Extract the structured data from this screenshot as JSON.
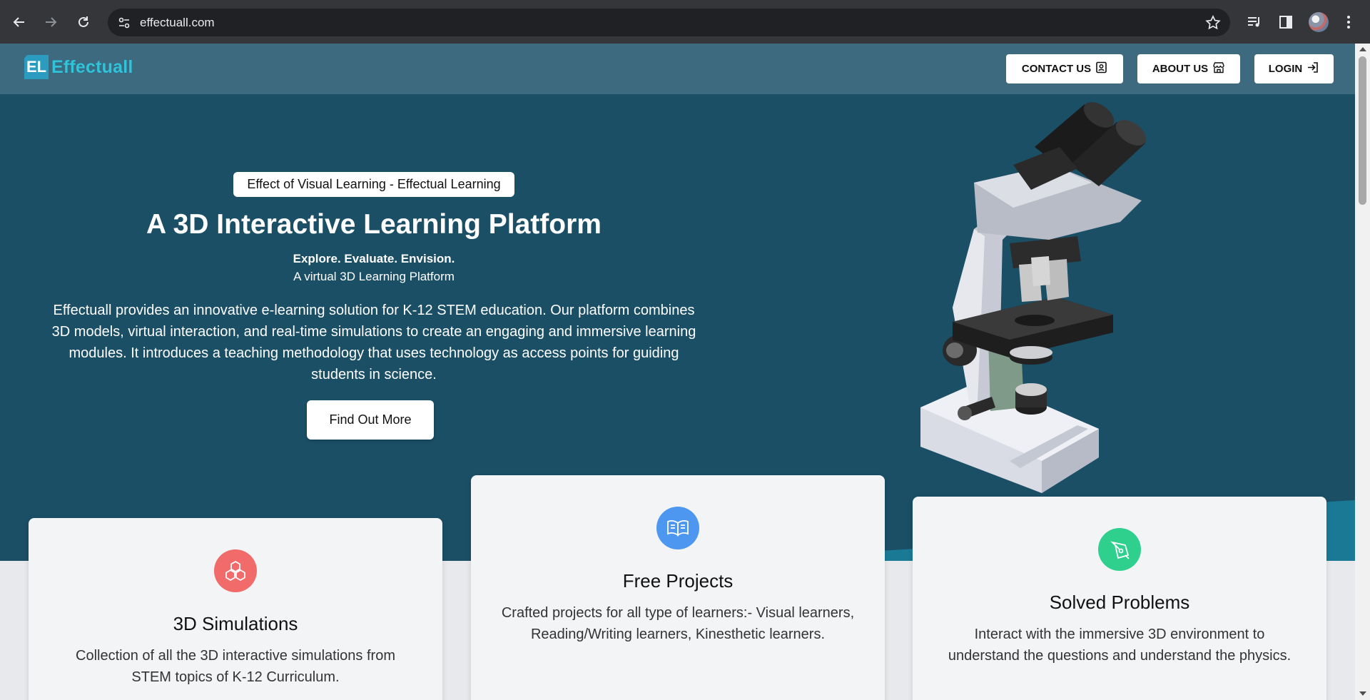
{
  "browser": {
    "url": "effectuall.com",
    "icons": [
      "back-icon",
      "forward-icon",
      "reload-icon",
      "site-info-icon",
      "bookmark-star-icon",
      "media-controls-icon",
      "side-panel-icon",
      "profile-avatar",
      "more-menu-icon"
    ]
  },
  "header": {
    "logo_mark": "EL",
    "logo_text": "Effectuall",
    "nav": [
      {
        "label": "CONTACT US",
        "icon": "contact-card-icon"
      },
      {
        "label": "ABOUT US",
        "icon": "store-icon"
      },
      {
        "label": "LOGIN",
        "icon": "login-icon"
      }
    ]
  },
  "hero": {
    "badge": "Effect of Visual Learning - Effectual Learning",
    "title": "A 3D Interactive Learning Platform",
    "tagline": "Explore. Evaluate. Envision.",
    "subtitle": "A virtual 3D Learning Platform",
    "description": "Effectuall provides an innovative e-learning solution for K-12 STEM education. Our platform combines 3D models, virtual interaction, and real-time simulations to create an engaging and immersive learning modules. It introduces a teaching methodology that uses technology as access points for guiding students in science.",
    "cta": "Find Out More",
    "image": "microscope-3d-model"
  },
  "features": [
    {
      "title": "3D Simulations",
      "description": "Collection of all the 3D interactive simulations from STEM topics of K-12 Curriculum.",
      "icon": "cubes-icon",
      "color": "#f16b6b"
    },
    {
      "title": "Free Projects",
      "description": "Crafted projects for all type of learners:- Visual learners, Reading/Writing learners, Kinesthetic learners.",
      "icon": "open-book-icon",
      "color": "#4d97f0"
    },
    {
      "title": "Solved Problems",
      "description": "Interact with the immersive 3D environment to understand the questions and understand the physics.",
      "icon": "pen-nib-icon",
      "color": "#2fcf8d"
    }
  ],
  "colors": {
    "hero_bg": "#1a4f66",
    "header_bg": "#3e6a80",
    "logo_accent": "#33c3d8",
    "card_bg": "#f3f4f6"
  }
}
